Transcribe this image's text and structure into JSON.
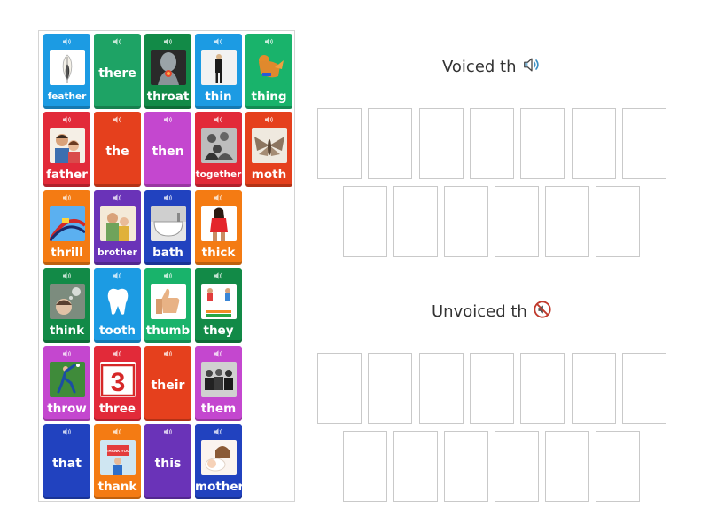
{
  "colors": {
    "blue_light": "#1c9be3",
    "green": "#1ea365",
    "green_dark": "#128a47",
    "red": "#e22a39",
    "orange_red": "#e5401d",
    "pink_magenta": "#c447cf",
    "orange": "#f47b13",
    "purple": "#6a33b8",
    "navy": "#2142bf",
    "teal": "#19b36b"
  },
  "cards": [
    {
      "word": "feather",
      "color": "#1c9be3",
      "picture": "feather"
    },
    {
      "word": "there",
      "color": "#1ea365",
      "picture": null
    },
    {
      "word": "throat",
      "color": "#128a47",
      "picture": "throat"
    },
    {
      "word": "thin",
      "color": "#1c9be3",
      "picture": "thin"
    },
    {
      "word": "thing",
      "color": "#19b36b",
      "picture": "thing"
    },
    {
      "word": "father",
      "color": "#e22a39",
      "picture": "father"
    },
    {
      "word": "the",
      "color": "#e5401d",
      "picture": null
    },
    {
      "word": "then",
      "color": "#c447cf",
      "picture": null
    },
    {
      "word": "together",
      "color": "#e22a39",
      "picture": "together"
    },
    {
      "word": "moth",
      "color": "#e5401d",
      "picture": "moth"
    },
    {
      "word": "thrill",
      "color": "#f47b13",
      "picture": "thrill"
    },
    {
      "word": "brother",
      "color": "#6a33b8",
      "picture": "brother"
    },
    {
      "word": "bath",
      "color": "#2142bf",
      "picture": "bath"
    },
    {
      "word": "thick",
      "color": "#f47b13",
      "picture": "thick"
    },
    {
      "word": "think",
      "color": "#128a47",
      "picture": "think"
    },
    {
      "word": "tooth",
      "color": "#1c9be3",
      "picture": "tooth"
    },
    {
      "word": "thumb",
      "color": "#19b36b",
      "picture": "thumb"
    },
    {
      "word": "they",
      "color": "#128a47",
      "picture": "they"
    },
    {
      "word": "throw",
      "color": "#c447cf",
      "picture": "throw"
    },
    {
      "word": "three",
      "color": "#e22a39",
      "picture": "three"
    },
    {
      "word": "their",
      "color": "#e5401d",
      "picture": null
    },
    {
      "word": "them",
      "color": "#c447cf",
      "picture": "them"
    },
    {
      "word": "that",
      "color": "#2142bf",
      "picture": null
    },
    {
      "word": "thank",
      "color": "#f47b13",
      "picture": "thank"
    },
    {
      "word": "this",
      "color": "#6a33b8",
      "picture": null
    },
    {
      "word": "mother",
      "color": "#2142bf",
      "picture": "mother"
    }
  ],
  "picture_labels": {
    "three_numeral": "3",
    "thank_sign": "THANK YOU"
  },
  "groups": [
    {
      "title": "Voiced th",
      "icon": "speaker-on-icon",
      "slot_count": 13
    },
    {
      "title": "Unvoiced th",
      "icon": "speaker-muted-icon",
      "slot_count": 13
    }
  ]
}
